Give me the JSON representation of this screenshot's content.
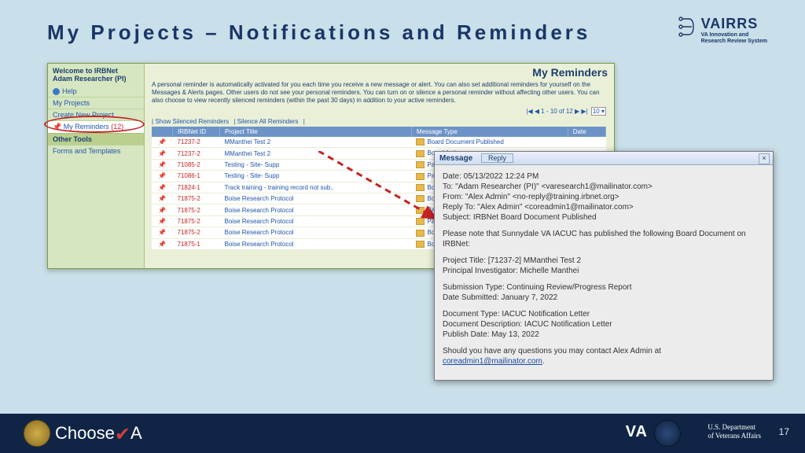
{
  "slide": {
    "title": "My Projects – Notifications and Reminders",
    "page_number": "17"
  },
  "branding": {
    "vairrs": "VAIRRS",
    "vairrs_sub1": "VA Innovation and",
    "vairrs_sub2": "Research Review System",
    "choose": "Choose",
    "choose_suffix": "A",
    "va": "VA",
    "dept1": "U.S. Department",
    "dept2": "of Veterans Affairs"
  },
  "sidebar": {
    "welcome": "Welcome to IRBNet",
    "user": "Adam Researcher (PI)",
    "help": "Help",
    "items": {
      "0": "My Projects",
      "1": "Create New Project",
      "2_label": "My Reminders",
      "2_count": "(12)"
    },
    "other_tools": "Other Tools",
    "forms": "Forms and Templates"
  },
  "main": {
    "title": "My Reminders",
    "intro": "A personal reminder is automatically activated for you each time you receive a new message or alert. You can also set additional reminders for yourself on the Messages & Alerts pages. Other users do not see your personal reminders. You can turn on or silence a personal reminder without affecting other users. You can also choose to view recently silenced reminders (within the past 30 days) in addition to your active reminders.",
    "pager_text": "1 - 10 of 12",
    "pager_size": "10",
    "link_show": "Show Silenced Reminders",
    "link_silence": "Silence All Reminders",
    "cols": {
      "id": "IRBNet ID",
      "title": "Project Title",
      "msg": "Message Type",
      "date": "Date"
    },
    "rows": [
      {
        "id": "71237-2",
        "title": "MManthei Test 2",
        "msg": "Board Document Published"
      },
      {
        "id": "71237-2",
        "title": "MManthei Test 2",
        "msg": "Board Action"
      },
      {
        "id": "71085-2",
        "title": "Testing - Site- Supp",
        "msg": "Package Unlocked"
      },
      {
        "id": "71086-1",
        "title": "Testing - Site- Supp",
        "msg": "Package Unlocked"
      },
      {
        "id": "71824-1",
        "title": "Track training - training record not sub..",
        "msg": "Board Action"
      },
      {
        "id": "71875-2",
        "title": "Boise Research Protocol",
        "msg": "Board Action"
      },
      {
        "id": "71875-2",
        "title": "Boise Research Protocol",
        "msg": "Package Unlocked"
      },
      {
        "id": "71875-2",
        "title": "Boise Research Protocol",
        "msg": "Package Unlocked"
      },
      {
        "id": "71875-2",
        "title": "Boise Research Protocol",
        "msg": "Board Action"
      },
      {
        "id": "71875-1",
        "title": "Boise Research Protocol",
        "msg": "Board Action"
      }
    ]
  },
  "message": {
    "header_label": "Message",
    "reply": "Reply",
    "close": "×",
    "l1": "Date: 05/13/2022 12:24 PM",
    "l2": "To: \"Adam Researcher (PI)\" <varesearch1@mailinator.com>",
    "l3": "From: \"Alex Admin\" <no-reply@training.irbnet.org>",
    "l4": "Reply To: \"Alex Admin\" <coreadmin1@mailinator.com>",
    "l5": "Subject: IRBNet Board Document Published",
    "p1": "Please note that Sunnydale VA IACUC has published the following Board Document on IRBNet:",
    "p2a": "Project Title: [71237-2] MManthei Test 2",
    "p2b": "Principal Investigator: Michelle Manthei",
    "p3a": "Submission Type: Continuing Review/Progress Report",
    "p3b": "Date Submitted: January 7, 2022",
    "p4a": "Document Type: IACUC Notification Letter",
    "p4b": "Document Description: IACUC Notification Letter",
    "p4c": "Publish Date: May 13, 2022",
    "p5_prefix": "Should you have any questions you may contact Alex Admin at ",
    "p5_email": "coreadmin1@mailinator.com"
  }
}
